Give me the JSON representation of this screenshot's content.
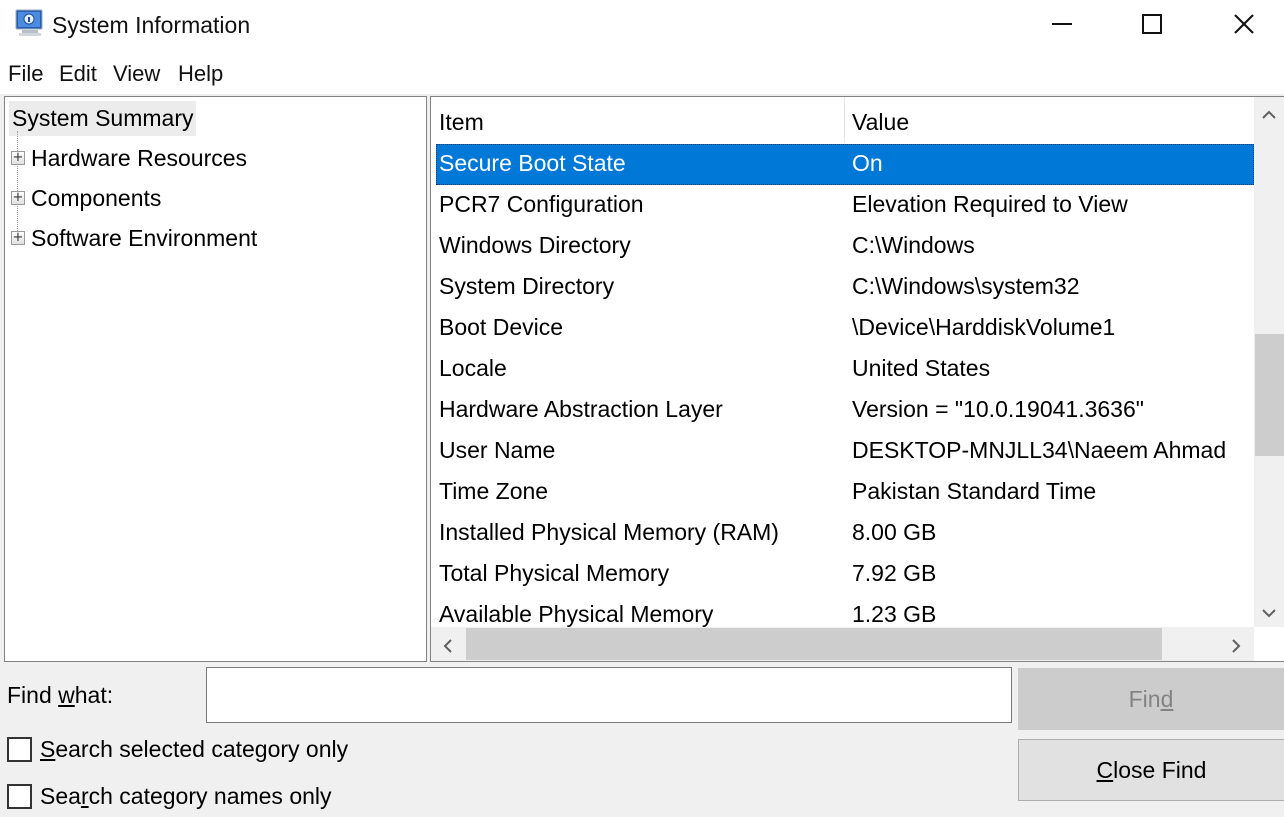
{
  "window": {
    "title": "System Information",
    "app_icon": "system-information-icon",
    "controls": {
      "minimize": "minimize-icon",
      "maximize": "maximize-icon",
      "close": "close-icon"
    }
  },
  "menu": [
    "File",
    "Edit",
    "View",
    "Help"
  ],
  "tree": {
    "root": "System Summary",
    "children": [
      {
        "label": "Hardware Resources",
        "expander": "+"
      },
      {
        "label": "Components",
        "expander": "+"
      },
      {
        "label": "Software Environment",
        "expander": "+"
      }
    ]
  },
  "list": {
    "columns": [
      "Item",
      "Value"
    ],
    "selected_index": 0,
    "rows": [
      {
        "item": "Secure Boot State",
        "value": "On"
      },
      {
        "item": "PCR7 Configuration",
        "value": "Elevation Required to View"
      },
      {
        "item": "Windows Directory",
        "value": "C:\\Windows"
      },
      {
        "item": "System Directory",
        "value": "C:\\Windows\\system32"
      },
      {
        "item": "Boot Device",
        "value": "\\Device\\HarddiskVolume1"
      },
      {
        "item": "Locale",
        "value": "United States"
      },
      {
        "item": "Hardware Abstraction Layer",
        "value": "Version = \"10.0.19041.3636\""
      },
      {
        "item": "User Name",
        "value": "DESKTOP-MNJLL34\\Naeem Ahmad"
      },
      {
        "item": "Time Zone",
        "value": "Pakistan Standard Time"
      },
      {
        "item": "Installed Physical Memory (RAM)",
        "value": "8.00 GB"
      },
      {
        "item": "Total Physical Memory",
        "value": "7.92 GB"
      },
      {
        "item": "Available Physical Memory",
        "value": "1.23 GB"
      }
    ],
    "scroll": {
      "up_arrow": "^",
      "down_arrow": "v",
      "left_arrow": "<",
      "right_arrow": ">"
    }
  },
  "find": {
    "label_pre": "Find ",
    "label_accel": "w",
    "label_post": "hat:",
    "input_value": "",
    "find_button": {
      "pre": "Fin",
      "accel": "d",
      "post": "",
      "enabled": false
    },
    "close_button": {
      "pre": "",
      "accel": "C",
      "post": "lose Find"
    },
    "options": [
      {
        "pre": "",
        "accel": "S",
        "post": "earch selected category only",
        "checked": false
      },
      {
        "pre": "Sea",
        "accel": "r",
        "post": "ch category names only",
        "checked": false
      }
    ]
  }
}
